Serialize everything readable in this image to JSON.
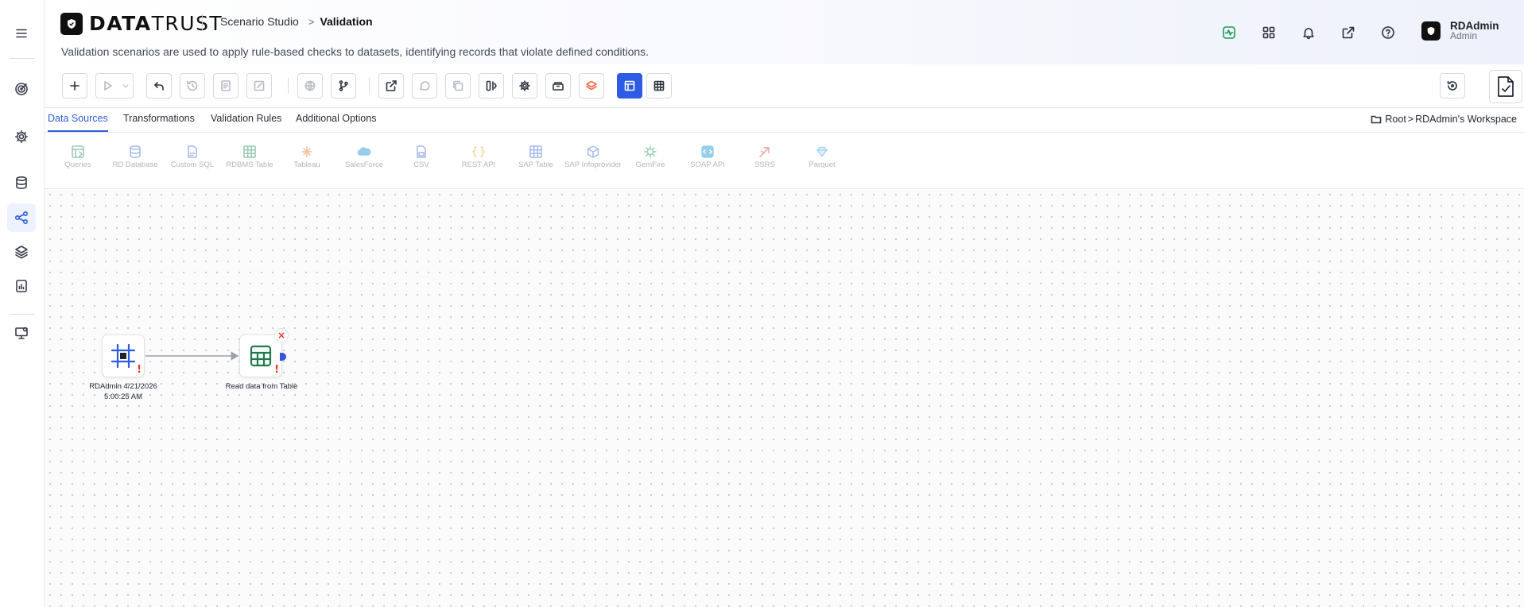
{
  "brand": {
    "logo_bold": "DATA",
    "logo_light": "TRUST"
  },
  "breadcrumb": {
    "parent": "Scenario Studio",
    "separator": ">",
    "current": "Validation"
  },
  "description": "Validation scenarios are used to apply rule-based checks to datasets, identifying records that violate defined conditions.",
  "header_icons": [
    "activity-icon",
    "apps-grid-icon",
    "bell-icon",
    "external-link-icon",
    "help-icon"
  ],
  "user": {
    "name": "RDAdmin",
    "role": "Admin"
  },
  "sidebar": {
    "items": [
      {
        "name": "menu-icon"
      },
      {
        "name": "target-icon"
      },
      {
        "name": "settings-icon"
      },
      {
        "name": "database-icon"
      },
      {
        "name": "workflow-icon",
        "active": true
      },
      {
        "name": "layers-icon"
      },
      {
        "name": "report-icon"
      },
      {
        "name": "monitor-settings-icon"
      }
    ]
  },
  "toolbar": {
    "buttons": [
      "add",
      "run",
      "run-options",
      "undo",
      "history",
      "save-draft",
      "edit",
      "globe",
      "branch",
      "open-external",
      "comment",
      "copy",
      "split-view",
      "settings",
      "archive",
      "layers",
      "layout-view",
      "table-view"
    ],
    "active_button": "layout-view"
  },
  "tabs": [
    {
      "label": "Data Sources",
      "active": true
    },
    {
      "label": "Transformations",
      "active": false
    },
    {
      "label": "Validation Rules",
      "active": false
    },
    {
      "label": "Additional Options",
      "active": false
    }
  ],
  "workspace": {
    "root": "Root",
    "separator": ">",
    "folder": "RDAdmin's Workspace"
  },
  "sources": [
    {
      "label": "Queries",
      "icon": "queries-icon",
      "color": "#1f8a5a"
    },
    {
      "label": "RD Database",
      "icon": "database-icon",
      "color": "#3a66d6"
    },
    {
      "label": "Custom SQL",
      "icon": "sql-file-icon",
      "color": "#3a66d6"
    },
    {
      "label": "RDBMS Table",
      "icon": "table-icon",
      "color": "#1f8a5a"
    },
    {
      "label": "Tableau",
      "icon": "tableau-icon",
      "color": "#e8762c"
    },
    {
      "label": "SalesForce",
      "icon": "salesforce-cloud-icon",
      "color": "#1b96d4"
    },
    {
      "label": "CSV",
      "icon": "csv-file-icon",
      "color": "#3a66d6"
    },
    {
      "label": "REST API",
      "icon": "braces-icon",
      "color": "#e8a21c"
    },
    {
      "label": "SAP Table",
      "icon": "sap-table-icon",
      "color": "#3a66d6"
    },
    {
      "label": "SAP Infoprovider",
      "icon": "cube-icon",
      "color": "#3a66d6"
    },
    {
      "label": "GemFire",
      "icon": "gemfire-icon",
      "color": "#1f9a5a"
    },
    {
      "label": "SOAP API",
      "icon": "soap-icon",
      "color": "#1b96d4"
    },
    {
      "label": "SSRS",
      "icon": "ssrs-icon",
      "color": "#d6342b"
    },
    {
      "label": "Parquet",
      "icon": "diamond-icon",
      "color": "#3aa6e8"
    }
  ],
  "canvas": {
    "nodes": [
      {
        "id": "start",
        "label": "RDAdmin 4/21/2026 5:00:25 AM",
        "icon": "scenario-start-icon",
        "warning": "!"
      },
      {
        "id": "read-table",
        "label": "Read data from Table",
        "icon": "table-icon",
        "warning": "!",
        "delete": "×"
      }
    ]
  },
  "colors": {
    "accent": "#2d5be3",
    "warning": "#e23b1d",
    "success": "#1b9a54"
  }
}
